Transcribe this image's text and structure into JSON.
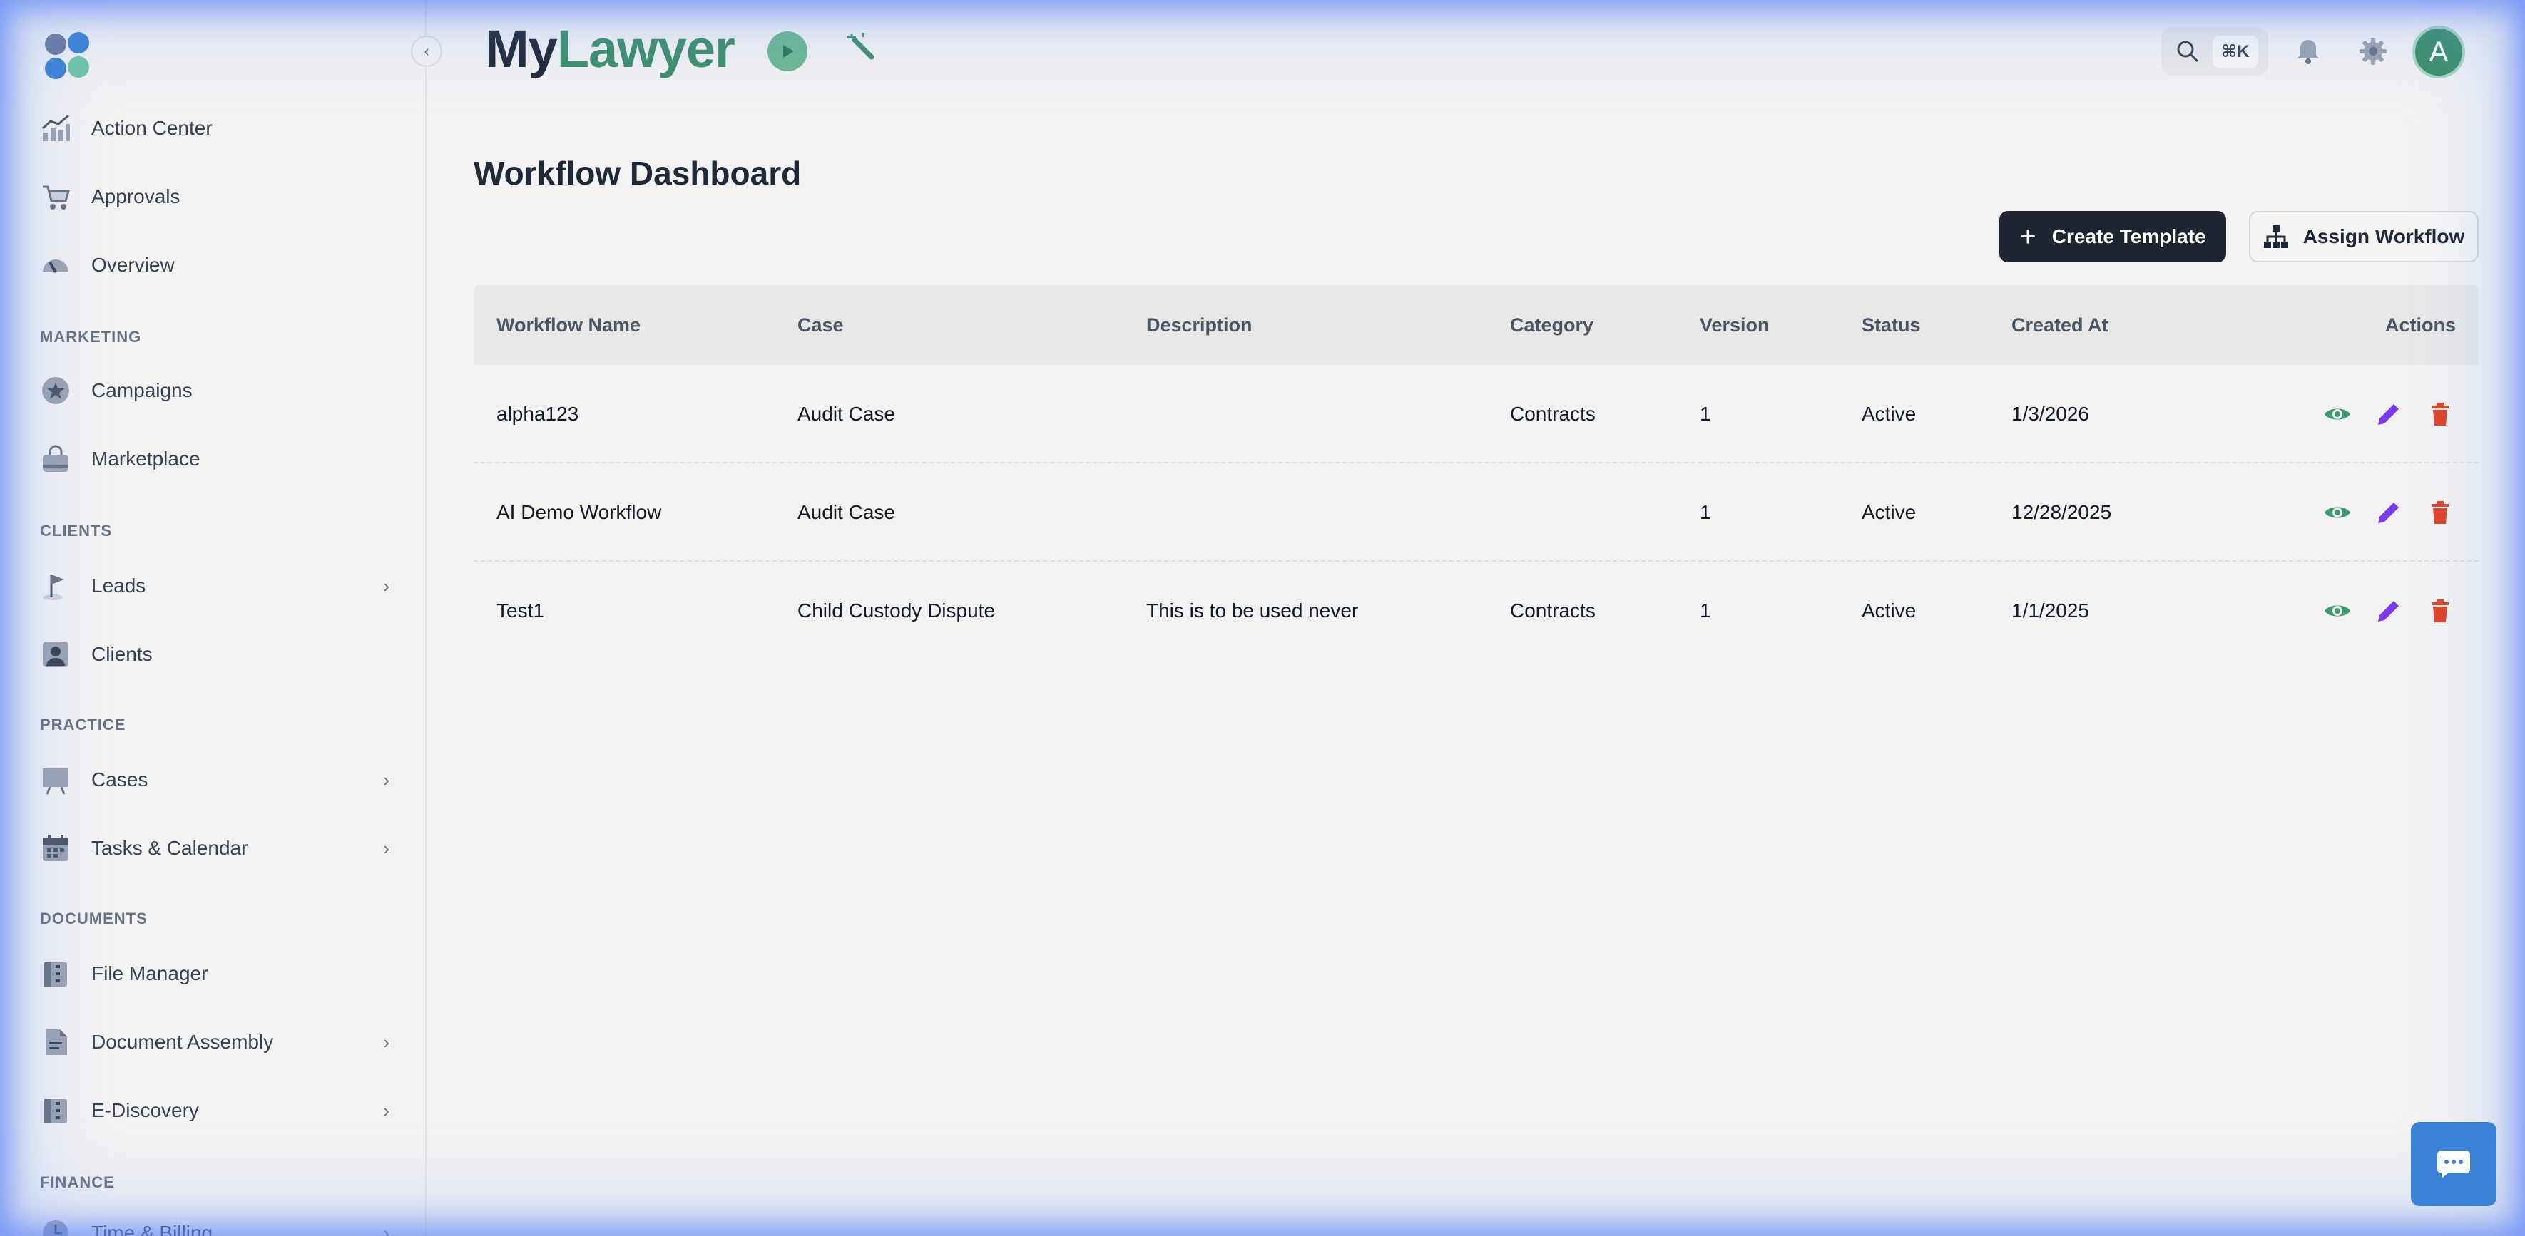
{
  "brand": {
    "part1": "My",
    "part2": "Lawyer"
  },
  "header": {
    "search_shortcut": "⌘K",
    "avatar_initial": "A"
  },
  "sidebar": {
    "items_top": [
      {
        "label": "Action Center",
        "icon": "chart-icon"
      },
      {
        "label": "Approvals",
        "icon": "cart-icon"
      },
      {
        "label": "Overview",
        "icon": "gauge-icon"
      }
    ],
    "sections": [
      {
        "title": "MARKETING",
        "items": [
          {
            "label": "Campaigns",
            "icon": "star-badge-icon"
          },
          {
            "label": "Marketplace",
            "icon": "bag-icon"
          }
        ]
      },
      {
        "title": "CLIENTS",
        "items": [
          {
            "label": "Leads",
            "icon": "flag-icon",
            "chevron": true
          },
          {
            "label": "Clients",
            "icon": "person-card-icon"
          }
        ]
      },
      {
        "title": "PRACTICE",
        "items": [
          {
            "label": "Cases",
            "icon": "board-icon",
            "chevron": true
          },
          {
            "label": "Tasks & Calendar",
            "icon": "calendar-icon",
            "chevron": true
          }
        ]
      },
      {
        "title": "DOCUMENTS",
        "items": [
          {
            "label": "File Manager",
            "icon": "binder-icon"
          },
          {
            "label": "Document Assembly",
            "icon": "document-icon",
            "chevron": true
          },
          {
            "label": "E-Discovery",
            "icon": "binder-icon",
            "chevron": true
          }
        ]
      },
      {
        "title": "FINANCE",
        "items": [
          {
            "label": "Time & Billing",
            "icon": "clock-icon",
            "chevron": true
          }
        ]
      }
    ]
  },
  "main": {
    "title": "Workflow Dashboard",
    "create_label": "Create Template",
    "assign_label": "Assign Workflow",
    "columns": [
      "Workflow Name",
      "Case",
      "Description",
      "Category",
      "Version",
      "Status",
      "Created At",
      "Actions"
    ],
    "rows": [
      {
        "name": "alpha123",
        "case": "Audit Case",
        "description": "",
        "category": "Contracts",
        "version": "1",
        "status": "Active",
        "created": "1/3/2026"
      },
      {
        "name": "AI Demo Workflow",
        "case": "Audit Case",
        "description": "",
        "category": "",
        "version": "1",
        "status": "Active",
        "created": "12/28/2025"
      },
      {
        "name": "Test1",
        "case": "Child Custody Dispute",
        "description": "This is to be used never",
        "category": "Contracts",
        "version": "1",
        "status": "Active",
        "created": "1/1/2025"
      }
    ]
  },
  "colors": {
    "brand_green": "#3d8f6a",
    "primary_button": "#1f2531",
    "view_icon": "#3d9a6e",
    "edit_icon": "#7c3aed",
    "delete_icon": "#e0452a",
    "chat_button": "#3b82d6"
  }
}
